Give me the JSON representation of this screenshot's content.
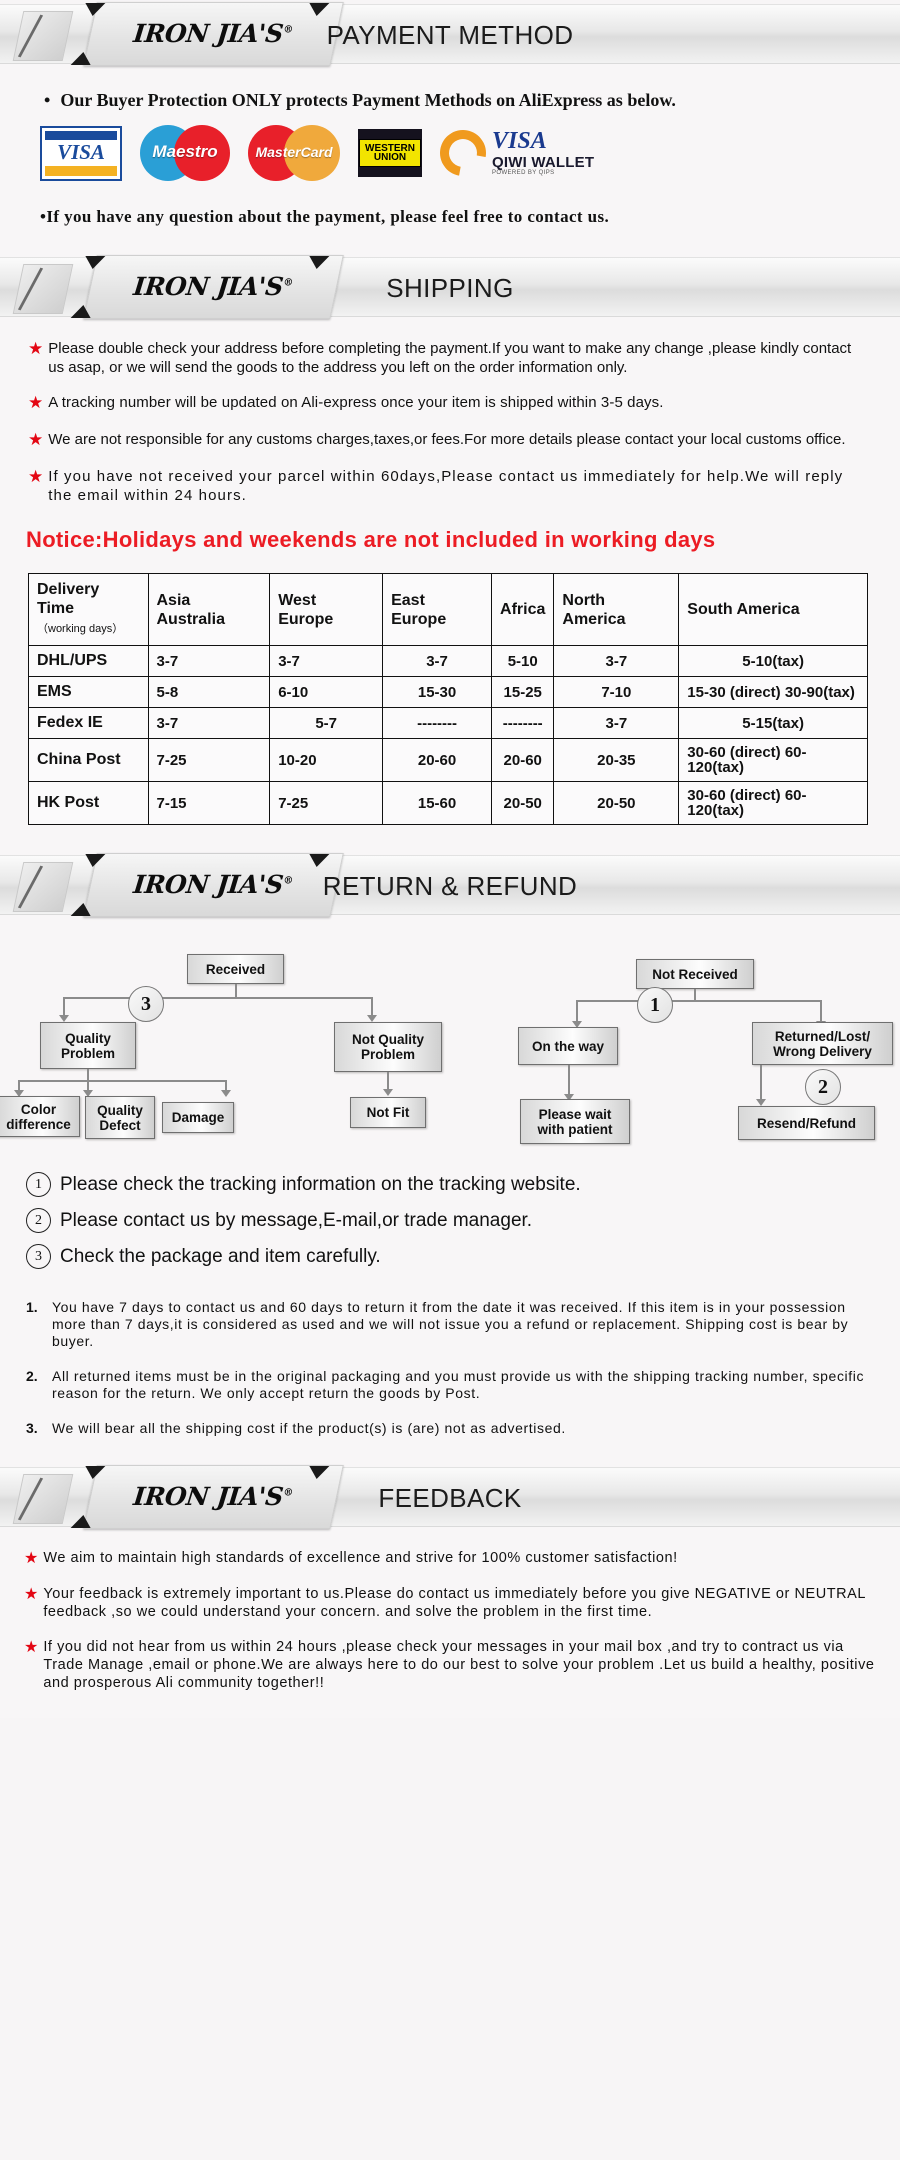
{
  "brand": {
    "name": "IRON JIA'S",
    "reg": "®"
  },
  "sections": {
    "payment": {
      "title": "PAYMENT METHOD",
      "bullet1": "Our Buyer Protection ONLY protects Payment Methods on AliExpress as below.",
      "bullet2": "If you have any question about the payment, please feel free to contact us.",
      "logos": [
        {
          "name": "visa-logo",
          "label": "VISA"
        },
        {
          "name": "maestro-logo",
          "label": "Maestro"
        },
        {
          "name": "mastercard-logo",
          "label": "MasterCard"
        },
        {
          "name": "western-union-logo",
          "label1": "WESTERN",
          "label2": "UNION"
        },
        {
          "name": "qiwi-wallet-logo",
          "label": "VISA",
          "label2": "QIWI WALLET",
          "label3": "POWERED BY QIPS"
        }
      ]
    },
    "shipping": {
      "title": "SHIPPING",
      "bullets": [
        "Please double check your address before completing the payment.If you want to make any change ,please kindly contact us asap, or we will send the goods to the address you left on the order information only.",
        "A tracking number will be updated on Ali-express once your item is shipped within 3-5 days.",
        "We are not responsible for any customs charges,taxes,or fees.For more details please contact your local customs office.",
        "If you have not received your parcel within 60days,Please contact us immediately for help.We will reply the email within 24 hours."
      ],
      "notice": "Notice:Holidays and weekends are not included in working days",
      "table": {
        "headers": [
          "Delivery Time",
          "Asia Australia",
          "West Europe",
          "East Europe",
          "Africa",
          "North America",
          "South America"
        ],
        "header_sub": "（working days）",
        "rows": [
          {
            "method": "DHL/UPS",
            "values": [
              "3-7",
              "3-7",
              "3-7",
              "5-10",
              "3-7",
              "5-10(tax)"
            ]
          },
          {
            "method": "EMS",
            "values": [
              "5-8",
              "6-10",
              "15-30",
              "15-25",
              "7-10",
              "15-30 (direct) 30-90(tax)"
            ]
          },
          {
            "method": "Fedex IE",
            "values": [
              "3-7",
              "5-7",
              "--------",
              "--------",
              "3-7",
              "5-15(tax)"
            ]
          },
          {
            "method": "China Post",
            "values": [
              "7-25",
              "10-20",
              "20-60",
              "20-60",
              "20-35",
              "30-60 (direct) 60-120(tax)"
            ]
          },
          {
            "method": "HK Post",
            "values": [
              "7-15",
              "7-25",
              "15-60",
              "20-50",
              "20-50",
              "30-60 (direct) 60-120(tax)"
            ]
          }
        ]
      }
    },
    "return": {
      "title": "RETURN & REFUND",
      "flow_left": {
        "root": "Received",
        "badge": "3",
        "branch_a": "Quality Problem",
        "branch_b": "Not Quality Problem",
        "leaves_a": [
          "Color difference",
          "Quality Defect",
          "Damage"
        ],
        "leaf_b": "Not Fit"
      },
      "flow_right": {
        "root": "Not  Received",
        "badge1": "1",
        "badge2": "2",
        "branch_a": "On the way",
        "branch_b": "Returned/Lost/ Wrong Delivery",
        "leaf_a": "Please wait with patient",
        "leaf_b": "Resend/Refund"
      },
      "notes": [
        {
          "num": "1",
          "text": "Please check the tracking information on the tracking website."
        },
        {
          "num": "2",
          "text": "Please contact us by  message,E-mail,or trade manager."
        },
        {
          "num": "3",
          "text": "Check the package and item carefully."
        }
      ],
      "policies": [
        {
          "n": "1.",
          "text": "You have 7 days to contact us and 60 days to return it from the date it was received. If this item is in your possession more than 7 days,it is considered as used and we will not issue you a refund or replacement. Shipping cost is bear by buyer."
        },
        {
          "n": "2.",
          "text": "All returned items must be in the original packaging and you must provide us with the shipping tracking number, specific reason for the return. We only accept return the goods by Post."
        },
        {
          "n": "3.",
          "text": "We will bear all the shipping cost if the product(s) is (are) not as advertised."
        }
      ]
    },
    "feedback": {
      "title": "FEEDBACK",
      "items": [
        "We aim to maintain high standards of excellence and strive  for 100% customer satisfaction!",
        "Your feedback is extremely important to us.Please do contact us immediately before you give NEGATIVE or NEUTRAL feedback ,so  we could understand your concern. and solve the problem in the first time.",
        "If you did not hear from us within 24 hours ,please check your messages in your mail box ,and try to contract us via Trade Manage ,email or phone.We are always here to do our best to solve your problem .Let us build a healthy, positive and prosperous Ali community together!!"
      ]
    }
  },
  "colors": {
    "red": "#e30613",
    "notice_red": "#ec1c24",
    "visa_blue": "#1a4b9c"
  }
}
